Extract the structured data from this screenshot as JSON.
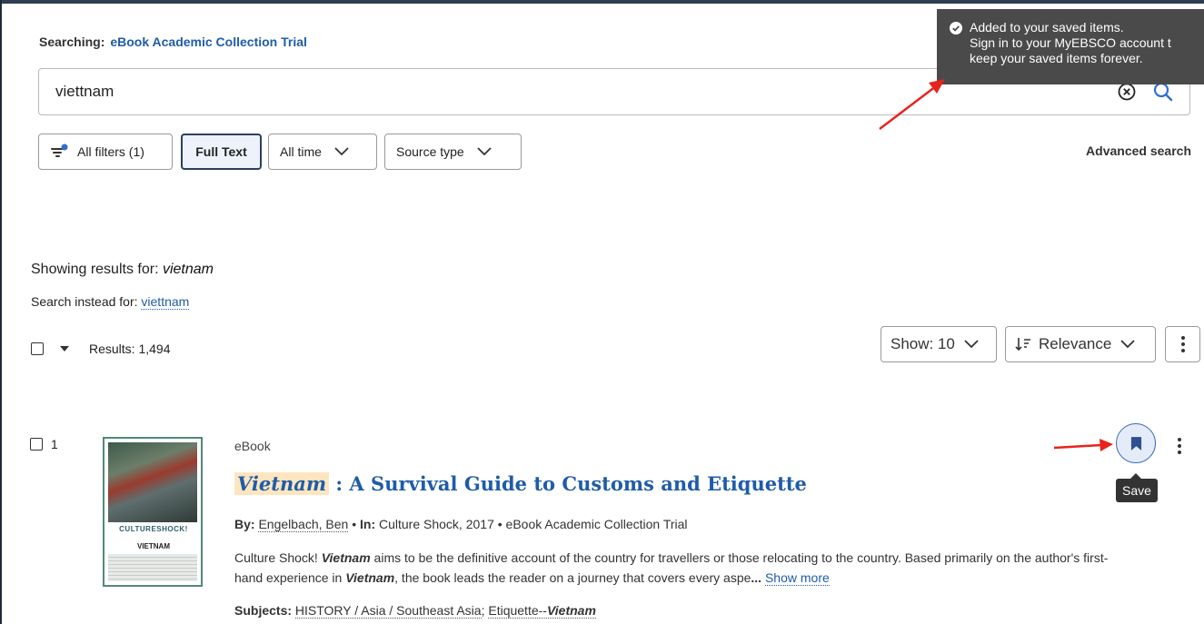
{
  "search": {
    "searching_label": "Searching:",
    "database": "eBook Academic Collection Trial",
    "query": "viettnam"
  },
  "filters": {
    "all_filters": "All filters (1)",
    "full_text": "Full Text",
    "all_time": "All time",
    "source_type": "Source type",
    "advanced": "Advanced search"
  },
  "results_header": {
    "showing_label": "Showing results for:",
    "showing_term": "vietnam",
    "instead_label": "Search instead for:",
    "instead_term": "viettnam",
    "count": "Results: 1,494",
    "show": "Show: 10",
    "sort": "Relevance"
  },
  "result": {
    "number": "1",
    "type": "eBook",
    "title_highlight": "Vietnam",
    "title_rest": " : A Survival Guide to Customs and Etiquette",
    "by_label": "By:",
    "author": "Engelbach, Ben",
    "sep1": " • ",
    "in_label": "In:",
    "in_value": " Culture Shock, 2017",
    "sep2": " • ",
    "collection": "eBook Academic Collection Trial",
    "abstract_1": "Culture Shock! ",
    "abstract_hl1": "Vietnam",
    "abstract_2": " aims to be the definitive account of the country for travellers or those relocating to the country. Based primarily on the author's first-hand experience in ",
    "abstract_hl2": "Vietnam",
    "abstract_3": ", the book leads the reader on a journey that covers every aspe",
    "abstract_ellipsis": "...",
    "show_more": "Show more",
    "subjects_label": "Subjects:",
    "subject1": "HISTORY / Asia / Southeast Asia",
    "subject_sep": "; ",
    "subject2_prefix": "Etiquette--",
    "subject2_hl": "Vietnam",
    "cover_brand": "CULTURESHOCK!",
    "cover_title": "VIETNAM",
    "save_tooltip": "Save"
  },
  "toast": {
    "line1": "Added to your saved items.",
    "line2": "Sign in to your MyEBSCO account t",
    "line3": "keep your saved items forever."
  },
  "colors": {
    "link": "#1f5ca8",
    "highlight": "#fde6bf",
    "annotation_arrow": "#e8231c",
    "toast_bg": "#4a4a4a"
  }
}
